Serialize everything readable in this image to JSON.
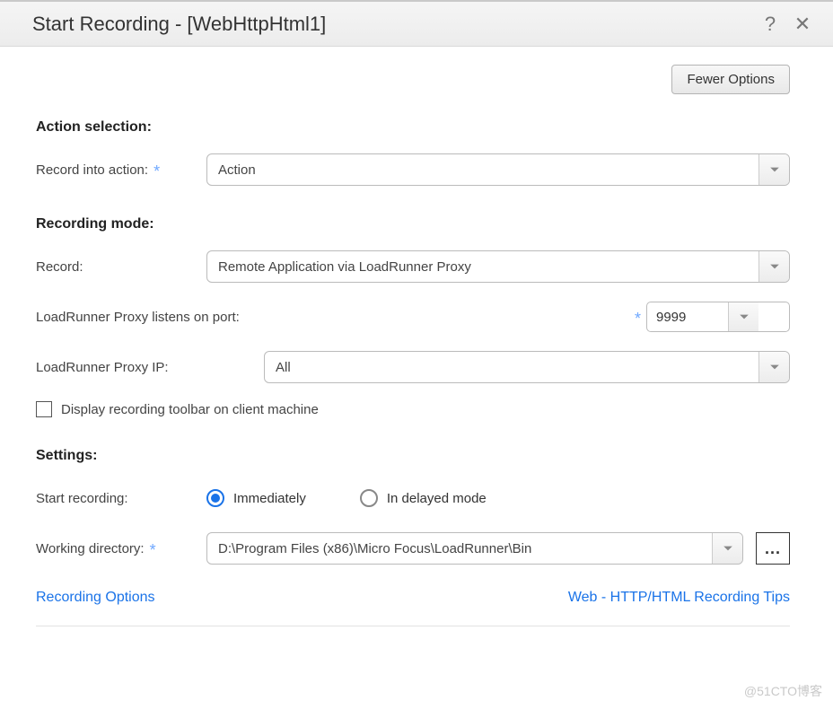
{
  "titlebar": {
    "title": "Start Recording - [WebHttpHtml1]",
    "help_icon": "?",
    "close_icon": "✕"
  },
  "toolbar": {
    "fewer_options": "Fewer Options"
  },
  "action_selection": {
    "header": "Action selection:",
    "label": "Record into action:",
    "value": "Action"
  },
  "recording_mode": {
    "header": "Recording mode:",
    "record_label": "Record:",
    "record_value": "Remote Application via LoadRunner Proxy",
    "port_label": "LoadRunner Proxy listens on port:",
    "port_value": "9999",
    "ip_label": "LoadRunner Proxy IP:",
    "ip_value": "All",
    "display_toolbar_label": "Display recording toolbar on client machine",
    "display_toolbar_checked": false
  },
  "settings": {
    "header": "Settings:",
    "start_label": "Start recording:",
    "option_immediately": "Immediately",
    "option_delayed": "In delayed mode",
    "selected": "immediately",
    "workdir_label": "Working directory:",
    "workdir_value": "D:\\Program Files (x86)\\Micro Focus\\LoadRunner\\Bin",
    "browse_label": "..."
  },
  "links": {
    "recording_options": "Recording Options",
    "recording_tips": "Web - HTTP/HTML Recording Tips"
  },
  "watermark": "@51CTO博客"
}
